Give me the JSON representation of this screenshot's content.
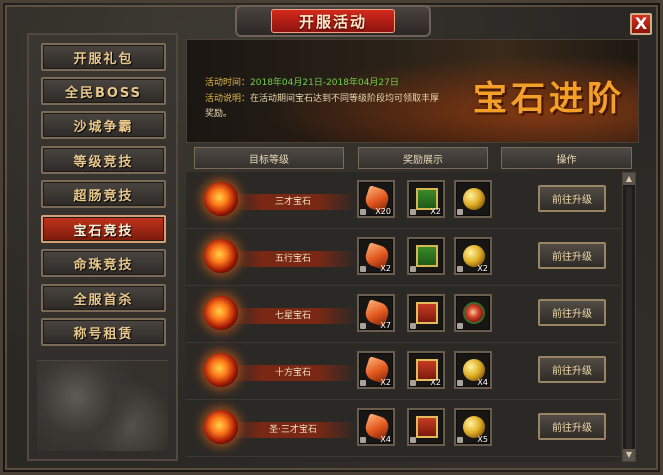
{
  "window": {
    "title": "开服活动",
    "close_label": "X"
  },
  "menu": {
    "items": [
      {
        "label": "开服礼包",
        "active": false
      },
      {
        "label": "全民BOSS",
        "active": false
      },
      {
        "label": "沙城争霸",
        "active": false
      },
      {
        "label": "等级竞技",
        "active": false
      },
      {
        "label": "超肠竞技",
        "active": false
      },
      {
        "label": "宝石竞技",
        "active": true
      },
      {
        "label": "命珠竞技",
        "active": false
      },
      {
        "label": "全服首杀",
        "active": false
      },
      {
        "label": "称号租赁",
        "active": false
      }
    ]
  },
  "banner": {
    "time_label": "活动时间：",
    "time_value": "2018年04月21日-2018年04月27日",
    "desc_label": "活动说明：",
    "desc_line1": "在活动期间宝石达到不同等级阶段均可领取丰厚",
    "desc_line2": "奖励。",
    "title": "宝石进阶"
  },
  "table": {
    "headers": [
      "目标等级",
      "奖励展示",
      "操作"
    ],
    "button_label": "前往升级",
    "rows": [
      {
        "gem": "三才宝石",
        "rewards": [
          {
            "icon": "orange-gem-icon",
            "qty": "X20"
          },
          {
            "icon": "green-book-icon",
            "qty": "X2"
          },
          {
            "icon": "gold-coin-icon",
            "qty": ""
          }
        ]
      },
      {
        "gem": "五行宝石",
        "rewards": [
          {
            "icon": "orange-gem-icon",
            "qty": "X2"
          },
          {
            "icon": "green-book-icon",
            "qty": ""
          },
          {
            "icon": "gold-coin-icon",
            "qty": "X2"
          }
        ]
      },
      {
        "gem": "七星宝石",
        "rewards": [
          {
            "icon": "orange-gem-icon",
            "qty": "X7"
          },
          {
            "icon": "red-book-icon",
            "qty": ""
          },
          {
            "icon": "red-medal-icon",
            "qty": ""
          }
        ]
      },
      {
        "gem": "十方宝石",
        "rewards": [
          {
            "icon": "orange-gem-icon",
            "qty": "X2"
          },
          {
            "icon": "red-book-icon",
            "qty": "X2"
          },
          {
            "icon": "gold-coin-icon",
            "qty": "X4"
          }
        ]
      },
      {
        "gem": "圣·三才宝石",
        "rewards": [
          {
            "icon": "orange-gem-icon",
            "qty": "X4"
          },
          {
            "icon": "red-book-icon",
            "qty": ""
          },
          {
            "icon": "gold-coin-icon",
            "qty": "X5"
          }
        ]
      }
    ]
  }
}
